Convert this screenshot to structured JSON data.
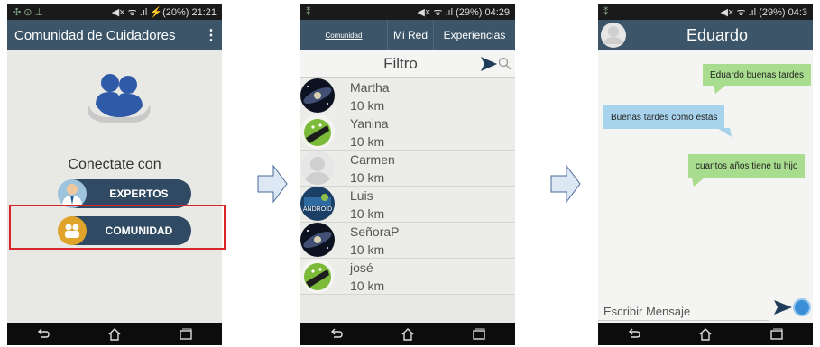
{
  "phone1": {
    "status_right": "◀× ᯤ .ıl ⚡(20%) 21:21",
    "status_left": "✣ ⊙ ⊥",
    "title": "Comunidad de Cuidadores",
    "menu": "⋮",
    "connect_text": "Conectate con",
    "btn_expertos": "EXPERTOS",
    "btn_comunidad": "COMUNIDAD"
  },
  "phone2": {
    "status_right": "◀× ᯤ .ıl (29%) 04:29",
    "tabs": [
      "Comunidad",
      "Mi Red",
      "Experiencias"
    ],
    "filter_label": "Filtro",
    "contacts": [
      {
        "name": "Martha",
        "distance": "10 km",
        "avatar": "galaxy"
      },
      {
        "name": "Yanina",
        "distance": "10 km",
        "avatar": "android"
      },
      {
        "name": "Carmen",
        "distance": "10 km",
        "avatar": "default"
      },
      {
        "name": "Luis",
        "distance": "10 km",
        "avatar": "android-logo"
      },
      {
        "name": "SeñoraP",
        "distance": "10 km",
        "avatar": "galaxy"
      },
      {
        "name": "josé",
        "distance": "10 km",
        "avatar": "android"
      }
    ]
  },
  "phone3": {
    "status_right": "◀× ᯤ .ıl (29%) 04:3",
    "contact_name": "Eduardo",
    "messages": [
      {
        "text": "Eduardo buenas tardes",
        "dir": "out"
      },
      {
        "text": "Buenas tardes como estas",
        "dir": "in"
      },
      {
        "text": "cuantos años tiene tu hijo",
        "dir": "out"
      }
    ],
    "input_placeholder": "Escribir Mensaje"
  },
  "colors": {
    "appbar": "#3c5568",
    "highlight": "#d9262b",
    "bubble_in": "#a7d3ec",
    "bubble_out": "#a8dc8e"
  }
}
